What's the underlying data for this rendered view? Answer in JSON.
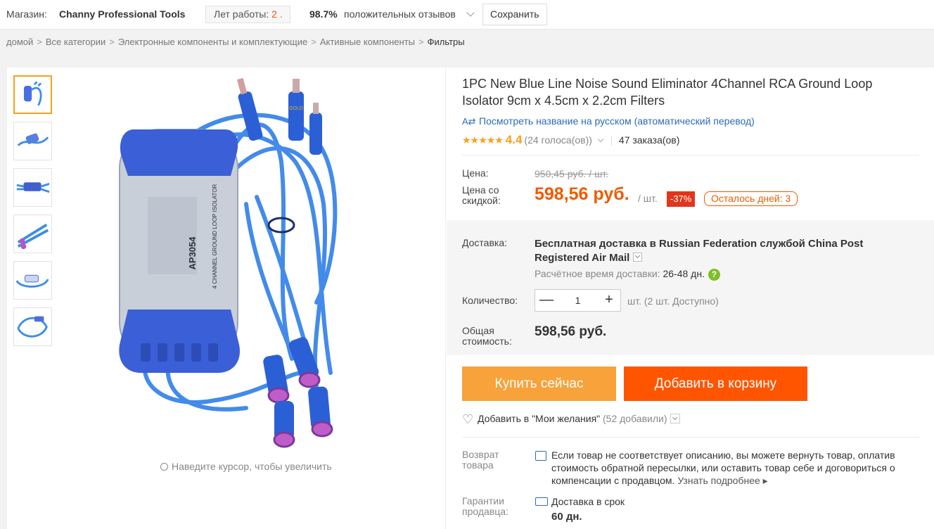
{
  "store": {
    "label": "Магазин:",
    "name": "Channy Professional Tools",
    "years_label": "Лет работы:",
    "years_value": "2 .",
    "feedback_pct": "98.7%",
    "feedback_text": "положительных отзывов",
    "save_label": "Сохранить"
  },
  "breadcrumb": {
    "items": [
      "домой",
      "Все категории",
      "Электронные компоненты и комплектующие",
      "Активные компоненты"
    ],
    "current": "Фильтры",
    "sep": ">"
  },
  "gallery": {
    "zoom_hint": "Наведите курсор, чтобы увеличить",
    "product_code": "AP3054",
    "product_caption": "4 CHANNEL GROUND LOOP ISOLATOR",
    "plug_text": "GOLD"
  },
  "product": {
    "title": "1PC New Blue Line Noise Sound Eliminator 4Channel RCA Ground Loop Isolator 9cm x 4.5cm x 2.2cm Filters",
    "translate_link": "Посмотреть название на русском (автоматический перевод)",
    "stars": "★★★★★",
    "rating_value": "4.4",
    "rating_fraction": 0.88,
    "votes": "(24 голоса(ов))",
    "orders": "47 заказа(ов)"
  },
  "pricing": {
    "price_label": "Цена:",
    "old_price": "950,45 руб. / шт.",
    "discount_label": "Цена со скидкой:",
    "new_price": "598,56 руб.",
    "per_unit": "/ шт.",
    "discount_badge": "-37%",
    "days_left": "Осталось дней: 3"
  },
  "shipping": {
    "label": "Доставка:",
    "text": "Бесплатная доставка в Russian Federation службой China Post Registered Air Mail",
    "eta_label": "Расчётное время доставки:",
    "eta_days": "26-48 дн.",
    "help": "?"
  },
  "quantity": {
    "label": "Количество:",
    "value": "1",
    "minus": "—",
    "plus": "+",
    "note": "шт. (2 шт. Доступно)"
  },
  "total": {
    "label": "Общая стоимость:",
    "value": "598,56 руб."
  },
  "actions": {
    "buy_now": "Купить сейчас",
    "add_to_cart": "Добавить в корзину",
    "wishlist": "Добавить в \"Мои желания\"",
    "wishlist_count": "(52 добавили)"
  },
  "returns": {
    "label": "Возврат товара",
    "text": "Если товар не соответствует описанию, вы можете вернуть товар, оплатив стоимость обратной пересылки, или оставить товар себе и договориться о компенсации с продавцом.",
    "more": "Узнать подробнее ▸"
  },
  "guarantee": {
    "label": "Гарантии продавца:",
    "text": "Доставка в срок",
    "days": "60 дн."
  },
  "colors": {
    "accent_orange": "#ff5500",
    "buy_orange": "#f7a23b",
    "price_orange": "#f05a00",
    "discount_red": "#e0361b",
    "link_blue": "#2b6bb8",
    "product_blue": "#3a5fd6"
  }
}
